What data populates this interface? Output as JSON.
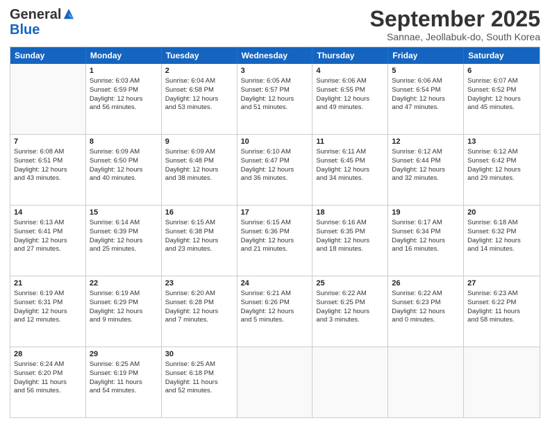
{
  "logo": {
    "line1": "General",
    "line2": "Blue"
  },
  "title": "September 2025",
  "subtitle": "Sannae, Jeollabuk-do, South Korea",
  "headers": [
    "Sunday",
    "Monday",
    "Tuesday",
    "Wednesday",
    "Thursday",
    "Friday",
    "Saturday"
  ],
  "weeks": [
    [
      {
        "day": "",
        "lines": []
      },
      {
        "day": "1",
        "lines": [
          "Sunrise: 6:03 AM",
          "Sunset: 6:59 PM",
          "Daylight: 12 hours",
          "and 56 minutes."
        ]
      },
      {
        "day": "2",
        "lines": [
          "Sunrise: 6:04 AM",
          "Sunset: 6:58 PM",
          "Daylight: 12 hours",
          "and 53 minutes."
        ]
      },
      {
        "day": "3",
        "lines": [
          "Sunrise: 6:05 AM",
          "Sunset: 6:57 PM",
          "Daylight: 12 hours",
          "and 51 minutes."
        ]
      },
      {
        "day": "4",
        "lines": [
          "Sunrise: 6:06 AM",
          "Sunset: 6:55 PM",
          "Daylight: 12 hours",
          "and 49 minutes."
        ]
      },
      {
        "day": "5",
        "lines": [
          "Sunrise: 6:06 AM",
          "Sunset: 6:54 PM",
          "Daylight: 12 hours",
          "and 47 minutes."
        ]
      },
      {
        "day": "6",
        "lines": [
          "Sunrise: 6:07 AM",
          "Sunset: 6:52 PM",
          "Daylight: 12 hours",
          "and 45 minutes."
        ]
      }
    ],
    [
      {
        "day": "7",
        "lines": [
          "Sunrise: 6:08 AM",
          "Sunset: 6:51 PM",
          "Daylight: 12 hours",
          "and 43 minutes."
        ]
      },
      {
        "day": "8",
        "lines": [
          "Sunrise: 6:09 AM",
          "Sunset: 6:50 PM",
          "Daylight: 12 hours",
          "and 40 minutes."
        ]
      },
      {
        "day": "9",
        "lines": [
          "Sunrise: 6:09 AM",
          "Sunset: 6:48 PM",
          "Daylight: 12 hours",
          "and 38 minutes."
        ]
      },
      {
        "day": "10",
        "lines": [
          "Sunrise: 6:10 AM",
          "Sunset: 6:47 PM",
          "Daylight: 12 hours",
          "and 36 minutes."
        ]
      },
      {
        "day": "11",
        "lines": [
          "Sunrise: 6:11 AM",
          "Sunset: 6:45 PM",
          "Daylight: 12 hours",
          "and 34 minutes."
        ]
      },
      {
        "day": "12",
        "lines": [
          "Sunrise: 6:12 AM",
          "Sunset: 6:44 PM",
          "Daylight: 12 hours",
          "and 32 minutes."
        ]
      },
      {
        "day": "13",
        "lines": [
          "Sunrise: 6:12 AM",
          "Sunset: 6:42 PM",
          "Daylight: 12 hours",
          "and 29 minutes."
        ]
      }
    ],
    [
      {
        "day": "14",
        "lines": [
          "Sunrise: 6:13 AM",
          "Sunset: 6:41 PM",
          "Daylight: 12 hours",
          "and 27 minutes."
        ]
      },
      {
        "day": "15",
        "lines": [
          "Sunrise: 6:14 AM",
          "Sunset: 6:39 PM",
          "Daylight: 12 hours",
          "and 25 minutes."
        ]
      },
      {
        "day": "16",
        "lines": [
          "Sunrise: 6:15 AM",
          "Sunset: 6:38 PM",
          "Daylight: 12 hours",
          "and 23 minutes."
        ]
      },
      {
        "day": "17",
        "lines": [
          "Sunrise: 6:15 AM",
          "Sunset: 6:36 PM",
          "Daylight: 12 hours",
          "and 21 minutes."
        ]
      },
      {
        "day": "18",
        "lines": [
          "Sunrise: 6:16 AM",
          "Sunset: 6:35 PM",
          "Daylight: 12 hours",
          "and 18 minutes."
        ]
      },
      {
        "day": "19",
        "lines": [
          "Sunrise: 6:17 AM",
          "Sunset: 6:34 PM",
          "Daylight: 12 hours",
          "and 16 minutes."
        ]
      },
      {
        "day": "20",
        "lines": [
          "Sunrise: 6:18 AM",
          "Sunset: 6:32 PM",
          "Daylight: 12 hours",
          "and 14 minutes."
        ]
      }
    ],
    [
      {
        "day": "21",
        "lines": [
          "Sunrise: 6:19 AM",
          "Sunset: 6:31 PM",
          "Daylight: 12 hours",
          "and 12 minutes."
        ]
      },
      {
        "day": "22",
        "lines": [
          "Sunrise: 6:19 AM",
          "Sunset: 6:29 PM",
          "Daylight: 12 hours",
          "and 9 minutes."
        ]
      },
      {
        "day": "23",
        "lines": [
          "Sunrise: 6:20 AM",
          "Sunset: 6:28 PM",
          "Daylight: 12 hours",
          "and 7 minutes."
        ]
      },
      {
        "day": "24",
        "lines": [
          "Sunrise: 6:21 AM",
          "Sunset: 6:26 PM",
          "Daylight: 12 hours",
          "and 5 minutes."
        ]
      },
      {
        "day": "25",
        "lines": [
          "Sunrise: 6:22 AM",
          "Sunset: 6:25 PM",
          "Daylight: 12 hours",
          "and 3 minutes."
        ]
      },
      {
        "day": "26",
        "lines": [
          "Sunrise: 6:22 AM",
          "Sunset: 6:23 PM",
          "Daylight: 12 hours",
          "and 0 minutes."
        ]
      },
      {
        "day": "27",
        "lines": [
          "Sunrise: 6:23 AM",
          "Sunset: 6:22 PM",
          "Daylight: 11 hours",
          "and 58 minutes."
        ]
      }
    ],
    [
      {
        "day": "28",
        "lines": [
          "Sunrise: 6:24 AM",
          "Sunset: 6:20 PM",
          "Daylight: 11 hours",
          "and 56 minutes."
        ]
      },
      {
        "day": "29",
        "lines": [
          "Sunrise: 6:25 AM",
          "Sunset: 6:19 PM",
          "Daylight: 11 hours",
          "and 54 minutes."
        ]
      },
      {
        "day": "30",
        "lines": [
          "Sunrise: 6:25 AM",
          "Sunset: 6:18 PM",
          "Daylight: 11 hours",
          "and 52 minutes."
        ]
      },
      {
        "day": "",
        "lines": []
      },
      {
        "day": "",
        "lines": []
      },
      {
        "day": "",
        "lines": []
      },
      {
        "day": "",
        "lines": []
      }
    ]
  ]
}
